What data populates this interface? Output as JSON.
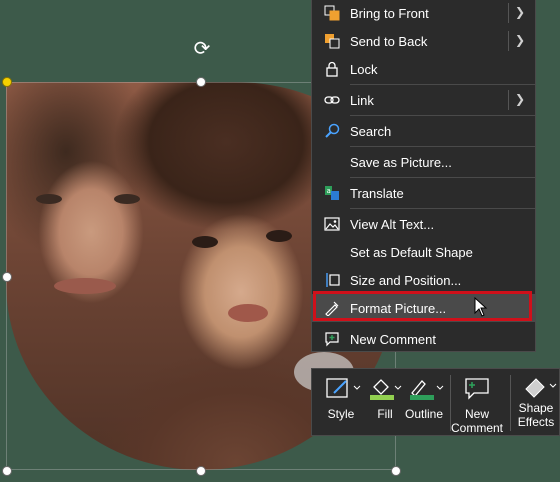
{
  "menu": {
    "items": [
      {
        "label": "Bring to Front",
        "icon": "bring-to-front-icon",
        "submenu": true
      },
      {
        "label": "Send to Back",
        "icon": "send-to-back-icon",
        "submenu": true
      },
      {
        "label": "Lock",
        "icon": "lock-icon",
        "submenu": false
      },
      {
        "label": "Link",
        "icon": "link-icon",
        "submenu": true
      },
      {
        "label": "Search",
        "icon": "search-icon",
        "submenu": false
      },
      {
        "label": "Save as Picture...",
        "icon": "",
        "submenu": false
      },
      {
        "label": "Translate",
        "icon": "translate-icon",
        "submenu": false
      },
      {
        "label": "View Alt Text...",
        "icon": "alt-text-icon",
        "submenu": false
      },
      {
        "label": "Set as Default Shape",
        "icon": "",
        "submenu": false
      },
      {
        "label": "Size and Position...",
        "icon": "size-position-icon",
        "submenu": false
      },
      {
        "label": "Format Picture...",
        "icon": "format-picture-icon",
        "submenu": false
      },
      {
        "label": "New Comment",
        "icon": "comment-icon",
        "submenu": false
      }
    ],
    "highlighted": "Format Picture...",
    "highlight_color": "#d0101a"
  },
  "toolbar": {
    "style_label": "Style",
    "fill_label": "Fill",
    "outline_label": "Outline",
    "new_comment_label_1": "New",
    "new_comment_label_2": "Comment",
    "shape_effects_label_1": "Shape",
    "shape_effects_label_2": "Effects"
  },
  "colors": {
    "background": "#3d5a4a",
    "menu_bg": "#2b2b2b",
    "fill_swatch": "#92d050",
    "outline_swatch": "#2e9e5a"
  }
}
